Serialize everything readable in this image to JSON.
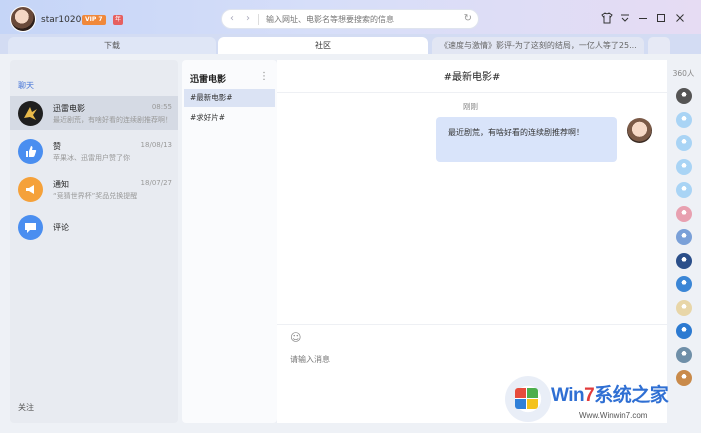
{
  "user": {
    "name": "star1020",
    "vip_badge": "VIP 7",
    "year_badge": "年"
  },
  "browser": {
    "back_icon": "chevron-left-icon",
    "forward_icon": "chevron-right-icon",
    "url_placeholder": "输入网址、电影名等想要搜索的信息",
    "refresh_icon": "refresh-icon"
  },
  "window_controls": {
    "skin": "shirt-icon",
    "menu": "dropdown-icon",
    "minimize": "minimize-icon",
    "maximize": "maximize-icon",
    "close": "close-icon"
  },
  "tabs": [
    {
      "label": "下载"
    },
    {
      "label": "社区"
    },
    {
      "label": "《速度与激情》影评-为了这刻的结局，一亿人等了25..."
    },
    {
      "label": ""
    }
  ],
  "sidebar": {
    "section_label": "聊天",
    "items": [
      {
        "title": "迅雷电影",
        "time": "08:55",
        "subtitle": "最近剧荒，有啥好看的连续剧推荐啊！",
        "color": "#1f1f1f"
      },
      {
        "title": "赞",
        "time": "18/08/13",
        "subtitle": "苹果冰、迅雷用户赞了你",
        "color": "#4a8ef0"
      },
      {
        "title": "通知",
        "time": "18/07/27",
        "subtitle": "“竞猜世界杯”奖品兑换提醒",
        "color": "#f5a13a"
      },
      {
        "title": "评论",
        "time": "",
        "subtitle": "",
        "color": "#4a8ef0"
      }
    ],
    "footer_label": "关注"
  },
  "group": {
    "title": "迅雷电影",
    "more_icon": "more-vertical-icon",
    "topics": [
      {
        "label": "#最新电影#"
      },
      {
        "label": "#求好片#"
      }
    ]
  },
  "chat": {
    "title": "#最新电影#",
    "message_time": "刚刚",
    "message_text": "最近剧荒，有啥好看的连续剧推荐啊！",
    "emoji_icon": "smiley-icon",
    "input_placeholder": "请输入消息"
  },
  "members": {
    "count_label": "360人",
    "avatar_colors": [
      "#555555",
      "#a9d4f5",
      "#a9d4f5",
      "#a9d4f5",
      "#a9d4f5",
      "#e8a0b0",
      "#7aa0d8",
      "#2b4f8a",
      "#3b86d6",
      "#e8d6a8",
      "#2c7ad1",
      "#6f8fa8",
      "#c98a4a"
    ]
  },
  "watermark": {
    "brand_prefix": "Win",
    "brand_seven": "7",
    "brand_suffix": "系统之家",
    "url": "Www.Winwin7.com"
  }
}
